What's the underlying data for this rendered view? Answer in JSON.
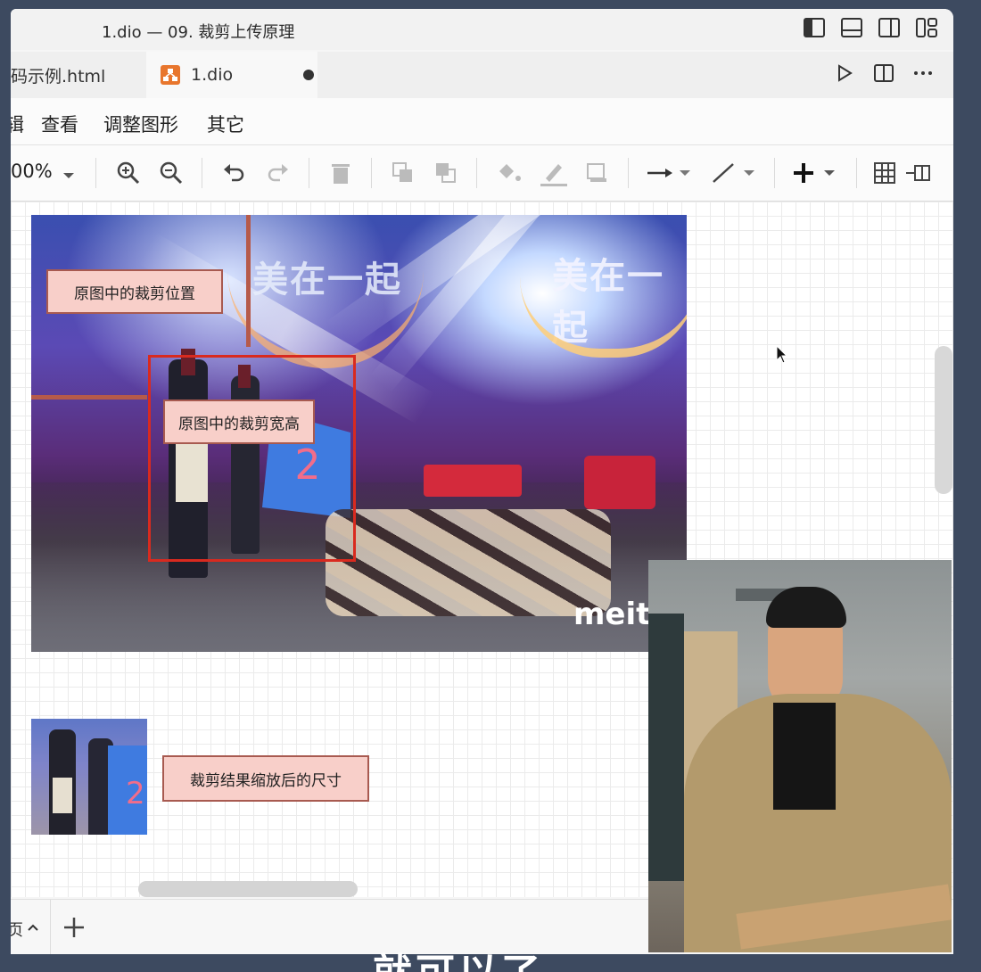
{
  "window": {
    "title": "1.dio — 09. 裁剪上传原理"
  },
  "tabs": [
    {
      "label": "码示例.html",
      "active": false
    },
    {
      "label": "1.dio",
      "active": true,
      "unsaved": true
    }
  ],
  "menu": [
    "辑",
    "查看",
    "调整图形",
    "其它"
  ],
  "toolbar": {
    "zoom": "00%"
  },
  "canvas": {
    "labels": {
      "crop_position": "原图中的裁剪位置",
      "crop_size": "原图中的裁剪宽高",
      "scaled_size": "裁剪结果缩放后的尺寸"
    },
    "photo": {
      "banner_text": "美在一起",
      "table_number": "2",
      "watermark": "meitu"
    }
  },
  "bottom": {
    "page_tab": "页"
  },
  "subtitle": "就可以了",
  "colors": {
    "label_fill": "#f8cfc9",
    "label_border": "#a85a50",
    "crop_rect": "#d92a1f",
    "position_lines": "#b65a4a"
  }
}
